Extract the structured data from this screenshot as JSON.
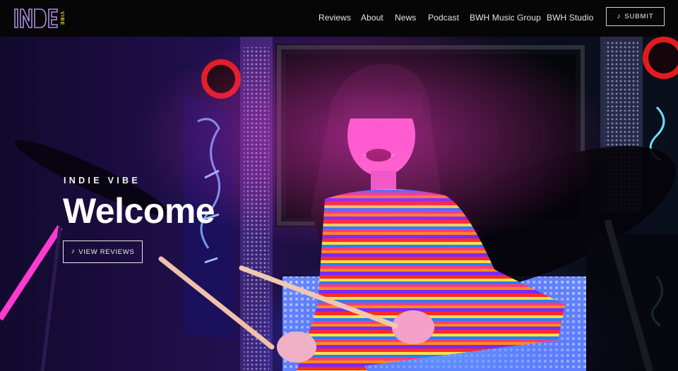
{
  "logo": {
    "main": "INDE",
    "side": "VIBE"
  },
  "nav": {
    "items": [
      {
        "label": "Reviews"
      },
      {
        "label": "About"
      },
      {
        "label": "News"
      },
      {
        "label": "Podcast"
      },
      {
        "label": "BWH Music Group"
      },
      {
        "label": "BWH Studio"
      }
    ],
    "submit_label": "SUBMIT",
    "submit_icon": "music-note-icon"
  },
  "hero": {
    "kicker": "INDIE VIBE",
    "title": "Welcome",
    "cta_label": "VIEW REVIEWS",
    "cta_icon": "music-note-icon",
    "image": "drummer-neon-photo"
  },
  "colors": {
    "topbar": "#060606",
    "logo_outline": "#a98fe0",
    "logo_accent": "#f0c93a",
    "hero_base": "#1a0b3a",
    "neon_pink": "#ff2bd6",
    "neon_blue": "#3b6bff"
  }
}
